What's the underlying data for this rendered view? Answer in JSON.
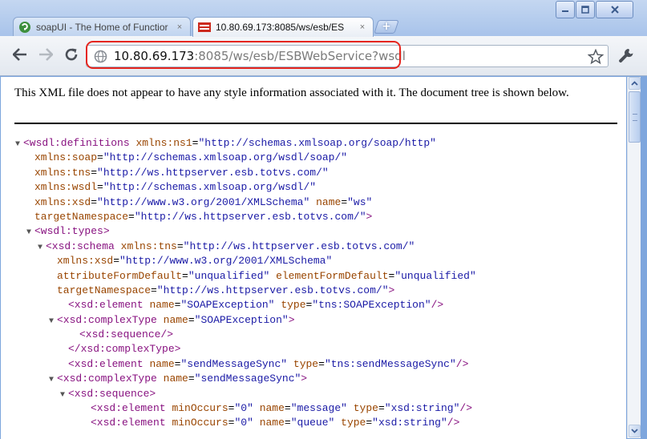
{
  "browser": {
    "tabs": [
      {
        "title": "soapUI - The Home of Functior",
        "favicon": "soapui-icon",
        "active": false,
        "close": "×"
      },
      {
        "title": "10.80.69.173:8085/ws/esb/ES",
        "favicon": "xml-page-icon",
        "active": true,
        "close": "×"
      }
    ],
    "new_tab_symbol": "+",
    "window_controls": [
      "minimize-icon",
      "maximize-icon",
      "close-icon"
    ],
    "nav": [
      "back-arrow-icon",
      "forward-arrow-icon",
      "reload-icon"
    ],
    "address": {
      "host": "10.80.69.173",
      "rest": ":8085/ws/esb/ESBWebService?wsdl"
    },
    "accent_highlight": "#e5251e"
  },
  "page": {
    "notice": "This XML file does not appear to have any style information associated with it. The document tree is shown below.",
    "xml_lines": [
      {
        "indent": 0,
        "toggle": "▼",
        "parts": [
          {
            "t": "tag",
            "s": "<wsdl:definitions"
          },
          {
            "t": "p",
            "s": " "
          },
          {
            "t": "attr",
            "s": "xmlns:ns1"
          },
          {
            "t": "p",
            "s": "="
          },
          {
            "t": "val",
            "s": "\"http://schemas.xmlsoap.org/soap/http\""
          }
        ]
      },
      {
        "indent": 1,
        "toggle": "",
        "parts": [
          {
            "t": "attr",
            "s": "xmlns:soap"
          },
          {
            "t": "p",
            "s": "="
          },
          {
            "t": "val",
            "s": "\"http://schemas.xmlsoap.org/wsdl/soap/\""
          }
        ]
      },
      {
        "indent": 1,
        "toggle": "",
        "parts": [
          {
            "t": "attr",
            "s": "xmlns:tns"
          },
          {
            "t": "p",
            "s": "="
          },
          {
            "t": "val",
            "s": "\"http://ws.httpserver.esb.totvs.com/\""
          }
        ]
      },
      {
        "indent": 1,
        "toggle": "",
        "parts": [
          {
            "t": "attr",
            "s": "xmlns:wsdl"
          },
          {
            "t": "p",
            "s": "="
          },
          {
            "t": "val",
            "s": "\"http://schemas.xmlsoap.org/wsdl/\""
          }
        ]
      },
      {
        "indent": 1,
        "toggle": "",
        "parts": [
          {
            "t": "attr",
            "s": "xmlns:xsd"
          },
          {
            "t": "p",
            "s": "="
          },
          {
            "t": "val",
            "s": "\"http://www.w3.org/2001/XMLSchema\""
          },
          {
            "t": "p",
            "s": " "
          },
          {
            "t": "attr",
            "s": "name"
          },
          {
            "t": "p",
            "s": "="
          },
          {
            "t": "val",
            "s": "\"ws\""
          }
        ]
      },
      {
        "indent": 1,
        "toggle": "",
        "parts": [
          {
            "t": "attr",
            "s": "targetNamespace"
          },
          {
            "t": "p",
            "s": "="
          },
          {
            "t": "val",
            "s": "\"http://ws.httpserver.esb.totvs.com/\""
          },
          {
            "t": "tag",
            "s": ">"
          }
        ]
      },
      {
        "indent": 1,
        "toggle": "▼",
        "parts": [
          {
            "t": "tag",
            "s": "<wsdl:types>"
          }
        ]
      },
      {
        "indent": 2,
        "toggle": "▼",
        "parts": [
          {
            "t": "tag",
            "s": "<xsd:schema"
          },
          {
            "t": "p",
            "s": " "
          },
          {
            "t": "attr",
            "s": "xmlns:tns"
          },
          {
            "t": "p",
            "s": "="
          },
          {
            "t": "val",
            "s": "\"http://ws.httpserver.esb.totvs.com/\""
          }
        ]
      },
      {
        "indent": 3,
        "toggle": "",
        "parts": [
          {
            "t": "attr",
            "s": "xmlns:xsd"
          },
          {
            "t": "p",
            "s": "="
          },
          {
            "t": "val",
            "s": "\"http://www.w3.org/2001/XMLSchema\""
          }
        ]
      },
      {
        "indent": 3,
        "toggle": "",
        "parts": [
          {
            "t": "attr",
            "s": "attributeFormDefault"
          },
          {
            "t": "p",
            "s": "="
          },
          {
            "t": "val",
            "s": "\"unqualified\""
          },
          {
            "t": "p",
            "s": " "
          },
          {
            "t": "attr",
            "s": "elementFormDefault"
          },
          {
            "t": "p",
            "s": "="
          },
          {
            "t": "val",
            "s": "\"unqualified\""
          }
        ]
      },
      {
        "indent": 3,
        "toggle": "",
        "parts": [
          {
            "t": "attr",
            "s": "targetNamespace"
          },
          {
            "t": "p",
            "s": "="
          },
          {
            "t": "val",
            "s": "\"http://ws.httpserver.esb.totvs.com/\""
          },
          {
            "t": "tag",
            "s": ">"
          }
        ]
      },
      {
        "indent": 4,
        "toggle": "",
        "parts": [
          {
            "t": "tag",
            "s": "<xsd:element"
          },
          {
            "t": "p",
            "s": " "
          },
          {
            "t": "attr",
            "s": "name"
          },
          {
            "t": "p",
            "s": "="
          },
          {
            "t": "val",
            "s": "\"SOAPException\""
          },
          {
            "t": "p",
            "s": " "
          },
          {
            "t": "attr",
            "s": "type"
          },
          {
            "t": "p",
            "s": "="
          },
          {
            "t": "val",
            "s": "\"tns:SOAPException\""
          },
          {
            "t": "tag",
            "s": "/>"
          }
        ]
      },
      {
        "indent": 3,
        "toggle": "▼",
        "parts": [
          {
            "t": "tag",
            "s": "<xsd:complexType"
          },
          {
            "t": "p",
            "s": " "
          },
          {
            "t": "attr",
            "s": "name"
          },
          {
            "t": "p",
            "s": "="
          },
          {
            "t": "val",
            "s": "\"SOAPException\""
          },
          {
            "t": "tag",
            "s": ">"
          }
        ]
      },
      {
        "indent": 5,
        "toggle": "",
        "parts": [
          {
            "t": "tag",
            "s": "<xsd:sequence/>"
          }
        ]
      },
      {
        "indent": 4,
        "toggle": "",
        "parts": [
          {
            "t": "tag",
            "s": "</xsd:complexType>"
          }
        ]
      },
      {
        "indent": 4,
        "toggle": "",
        "parts": [
          {
            "t": "tag",
            "s": "<xsd:element"
          },
          {
            "t": "p",
            "s": " "
          },
          {
            "t": "attr",
            "s": "name"
          },
          {
            "t": "p",
            "s": "="
          },
          {
            "t": "val",
            "s": "\"sendMessageSync\""
          },
          {
            "t": "p",
            "s": " "
          },
          {
            "t": "attr",
            "s": "type"
          },
          {
            "t": "p",
            "s": "="
          },
          {
            "t": "val",
            "s": "\"tns:sendMessageSync\""
          },
          {
            "t": "tag",
            "s": "/>"
          }
        ]
      },
      {
        "indent": 3,
        "toggle": "▼",
        "parts": [
          {
            "t": "tag",
            "s": "<xsd:complexType"
          },
          {
            "t": "p",
            "s": " "
          },
          {
            "t": "attr",
            "s": "name"
          },
          {
            "t": "p",
            "s": "="
          },
          {
            "t": "val",
            "s": "\"sendMessageSync\""
          },
          {
            "t": "tag",
            "s": ">"
          }
        ]
      },
      {
        "indent": 4,
        "toggle": "▼",
        "parts": [
          {
            "t": "tag",
            "s": "<xsd:sequence>"
          }
        ]
      },
      {
        "indent": 6,
        "toggle": "",
        "parts": [
          {
            "t": "tag",
            "s": "<xsd:element"
          },
          {
            "t": "p",
            "s": " "
          },
          {
            "t": "attr",
            "s": "minOccurs"
          },
          {
            "t": "p",
            "s": "="
          },
          {
            "t": "val",
            "s": "\"0\""
          },
          {
            "t": "p",
            "s": " "
          },
          {
            "t": "attr",
            "s": "name"
          },
          {
            "t": "p",
            "s": "="
          },
          {
            "t": "val",
            "s": "\"message\""
          },
          {
            "t": "p",
            "s": " "
          },
          {
            "t": "attr",
            "s": "type"
          },
          {
            "t": "p",
            "s": "="
          },
          {
            "t": "val",
            "s": "\"xsd:string\""
          },
          {
            "t": "tag",
            "s": "/>"
          }
        ]
      },
      {
        "indent": 6,
        "toggle": "",
        "parts": [
          {
            "t": "tag",
            "s": "<xsd:element"
          },
          {
            "t": "p",
            "s": " "
          },
          {
            "t": "attr",
            "s": "minOccurs"
          },
          {
            "t": "p",
            "s": "="
          },
          {
            "t": "val",
            "s": "\"0\""
          },
          {
            "t": "p",
            "s": " "
          },
          {
            "t": "attr",
            "s": "name"
          },
          {
            "t": "p",
            "s": "="
          },
          {
            "t": "val",
            "s": "\"queue\""
          },
          {
            "t": "p",
            "s": " "
          },
          {
            "t": "attr",
            "s": "type"
          },
          {
            "t": "p",
            "s": "="
          },
          {
            "t": "val",
            "s": "\"xsd:string\""
          },
          {
            "t": "tag",
            "s": "/>"
          }
        ]
      }
    ]
  }
}
